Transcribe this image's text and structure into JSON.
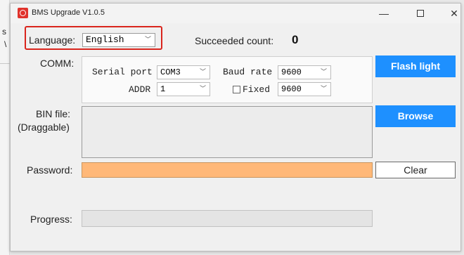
{
  "background": {
    "left_char_1": "s",
    "left_char_2": "\\"
  },
  "window": {
    "title": "BMS Upgrade V1.0.5",
    "minimize_glyph": "—",
    "close_glyph": "✕"
  },
  "language": {
    "label": "Language:",
    "value": "English"
  },
  "succeeded": {
    "label": "Succeeded count:",
    "value": "0"
  },
  "comm": {
    "label": "COMM:",
    "serial_port_label": "Serial port",
    "serial_port_value": "COM3",
    "baud_rate_label": "Baud rate",
    "baud_rate_value": "9600",
    "addr_label": "ADDR",
    "addr_value": "1",
    "fixed_label": "Fixed",
    "fixed_value": "9600",
    "fixed_checked": false
  },
  "buttons": {
    "flash_light": "Flash light",
    "browse": "Browse",
    "clear": "Clear"
  },
  "bin_file": {
    "label_line1": "BIN file:",
    "label_line2": "(Draggable)",
    "value": ""
  },
  "password": {
    "label": "Password:",
    "value": ""
  },
  "progress": {
    "label": "Progress:",
    "value": 0
  },
  "colors": {
    "accent_blue": "#1e90ff",
    "password_bg": "#ffb878",
    "highlight_red": "#d9251d",
    "app_icon_red": "#e0332c"
  }
}
